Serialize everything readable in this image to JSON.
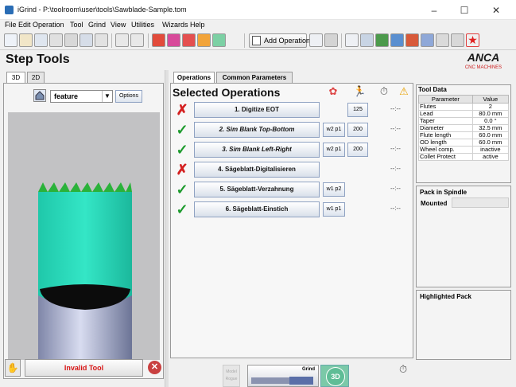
{
  "window": {
    "title": "iGrind - P:\\toolroom\\user\\tools\\Sawblade-Sample.tom",
    "minimize": "–",
    "maximize": "☐",
    "close": "✕"
  },
  "menu": [
    "File",
    "Edit",
    "Operation",
    "Tool",
    "Grind",
    "View",
    "Utilities",
    "Wizards",
    "Help"
  ],
  "toolbar": {
    "add_operation_label": "Add Operation"
  },
  "page": {
    "title": "Step Tools",
    "brand_logo": "ANCA CNC MACHINES"
  },
  "left": {
    "tabs": [
      "3D",
      "2D"
    ],
    "active_tab": "3D",
    "feature_select": "feature",
    "options_label": "Options",
    "invalid_tool_label": "Invalid Tool"
  },
  "operations": {
    "tabs": [
      "Operations",
      "Common Parameters"
    ],
    "active_tab": "Operations",
    "heading": "Selected Operations",
    "rows": [
      {
        "status": "fail",
        "status_glyph": "✗",
        "label": "1. Digitize EOT",
        "italic": false,
        "wheel": "",
        "value": "125",
        "time": "--:--"
      },
      {
        "status": "ok",
        "status_glyph": "✓",
        "label": "2. Sim Blank Top-Bottom",
        "italic": true,
        "wheel": "w2 p1",
        "value": "200",
        "time": "--:--"
      },
      {
        "status": "ok",
        "status_glyph": "✓",
        "label": "3. Sim Blank Left-Right",
        "italic": true,
        "wheel": "w2 p1",
        "value": "200",
        "time": "--:--"
      },
      {
        "status": "fail",
        "status_glyph": "✗",
        "label": "4. Sägeblatt-Digitalisieren",
        "italic": false,
        "wheel": "",
        "value": "",
        "time": "--:--"
      },
      {
        "status": "ok",
        "status_glyph": "✓",
        "label": "5. Sägeblatt-Verzahnung",
        "italic": false,
        "wheel": "w1 p2",
        "value": "",
        "time": "--:--"
      },
      {
        "status": "ok",
        "status_glyph": "✓",
        "label": "6. Sägeblatt-Einstich",
        "italic": false,
        "wheel": "w1 p1",
        "value": "",
        "time": "--:--"
      }
    ]
  },
  "tool_data": {
    "heading": "Tool Data",
    "columns": [
      "Parameter",
      "Value"
    ],
    "rows": [
      [
        "Flutes",
        "2"
      ],
      [
        "Lead",
        "80.0 mm"
      ],
      [
        "Taper",
        "0.0 °"
      ],
      [
        "Diameter",
        "32.5 mm"
      ],
      [
        "Flute length",
        "60.0 mm"
      ],
      [
        "OD length",
        "60.0 mm"
      ],
      [
        "Wheel comp.",
        "inactive"
      ],
      [
        "Collet Protect",
        "active"
      ]
    ]
  },
  "pack": {
    "heading": "Pack in Spindle",
    "mounted_label": "Mounted",
    "mounted_value": ""
  },
  "highlighted_pack": {
    "heading": "Highlighted Pack"
  },
  "bottom": {
    "grind_label": "Grind",
    "model_label": "Model Rogue",
    "view3d_label": "3D"
  },
  "colors": {
    "ok": "#1c9a2c",
    "fail": "#d42020",
    "invalid_text": "#d71414",
    "tool_body": "#2ee0c0",
    "teeth": "#2ab23a"
  }
}
